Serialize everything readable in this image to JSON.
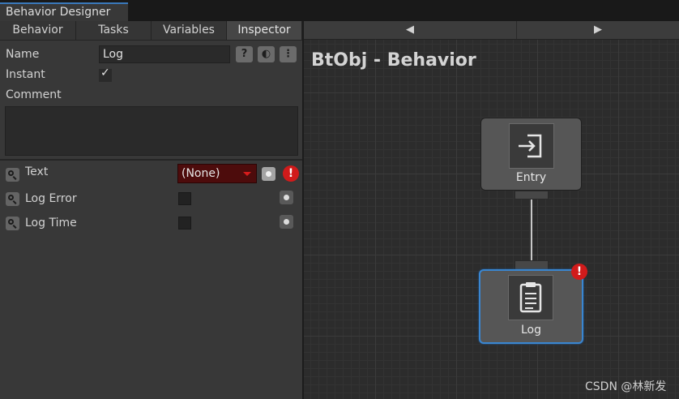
{
  "window": {
    "title": "Behavior Designer"
  },
  "tabs": [
    "Behavior",
    "Tasks",
    "Variables",
    "Inspector"
  ],
  "inspector": {
    "name_label": "Name",
    "name_value": "Log",
    "header_buttons": [
      "?",
      "◐",
      "⋮"
    ],
    "instant_label": "Instant",
    "instant_checked": true,
    "comment_label": "Comment",
    "comment_value": "",
    "fields": [
      {
        "label": "Text",
        "value": "(None)"
      },
      {
        "label": "Log Error"
      },
      {
        "label": "Log Time"
      }
    ],
    "warning_glyph": "!"
  },
  "graph": {
    "nav_prev": "◀",
    "nav_next": "▶",
    "title": "BtObj - Behavior",
    "nodes": [
      {
        "label": "Entry",
        "icon": "entry-icon"
      },
      {
        "label": "Log",
        "icon": "clipboard-icon"
      }
    ]
  },
  "watermark": "CSDN @林新发",
  "colors": {
    "accent": "#3a86d0",
    "error": "#d11b1b",
    "dropdown_error_bg": "#4d0c0c"
  }
}
